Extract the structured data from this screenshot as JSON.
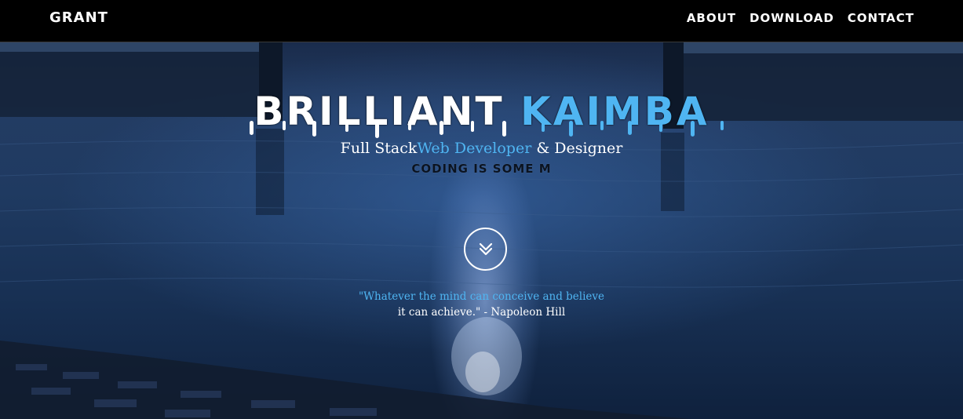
{
  "nav": {
    "brand": "GRANT",
    "links": [
      "ABOUT",
      "DOWNLOAD",
      "CONTACT"
    ]
  },
  "hero": {
    "title_part1": "BRILLIANT",
    "title_part2": "KAIMBA",
    "subtitle_prefix": "Full Stack",
    "subtitle_accent": "Web Developer",
    "subtitle_suffix": " & Designer",
    "typing_text": "CODING IS SOME M",
    "quote_line1": "\"Whatever the mind can conceive and believe",
    "quote_line2": "it can achieve.\" - Napoleon Hill"
  },
  "icons": {
    "scroll": "double-chevron-down-icon"
  },
  "colors": {
    "accent": "#4fb5f2",
    "navbar": "#000000",
    "text": "#ffffff"
  }
}
